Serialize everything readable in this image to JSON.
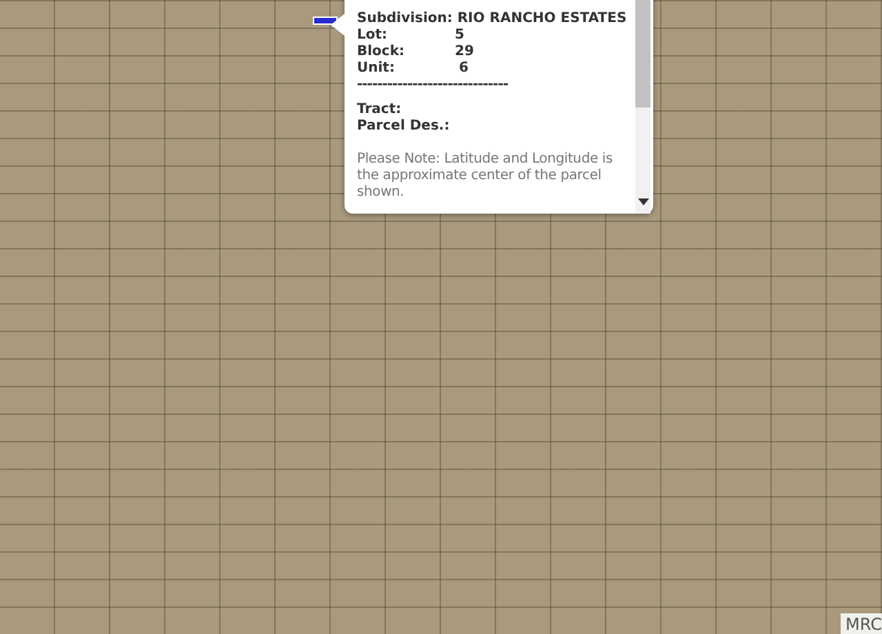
{
  "popup": {
    "subdivision_label": "Subdivision:",
    "subdivision": "RIO RANCHO ESTATES",
    "fields": [
      {
        "label": "Lot:",
        "value": "5"
      },
      {
        "label": "Block:",
        "value": "29"
      },
      {
        "label": "Unit:",
        "value": "6"
      }
    ],
    "separator": "------------------------------",
    "extra_fields": [
      {
        "label": "Tract:"
      },
      {
        "label": "Parcel Des.:"
      }
    ],
    "note": "Please Note: Latitude and Longitude is the approximate center of the parcel shown."
  },
  "attribution": "MRC"
}
